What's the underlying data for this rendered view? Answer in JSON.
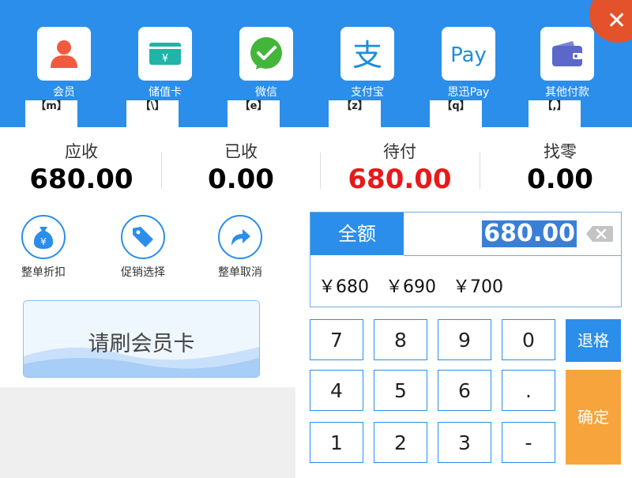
{
  "payments": [
    {
      "label": "会员",
      "key": "【m】",
      "icon": "member-icon"
    },
    {
      "label": "储值卡",
      "key": "【\\】",
      "icon": "stored-card-icon"
    },
    {
      "label": "微信",
      "key": "【e】",
      "icon": "wechat-icon"
    },
    {
      "label": "支付宝",
      "key": "【z】",
      "icon": "alipay-icon"
    },
    {
      "label": "思迅Pay",
      "key": "【q】",
      "icon": "sixun-pay-icon"
    },
    {
      "label": "其他付款",
      "key": "【,】",
      "icon": "wallet-icon"
    }
  ],
  "payment_icon_texts": {
    "stored_card": "¥",
    "alipay": "支",
    "sixun_pay": "Pay"
  },
  "summary": {
    "receivable": {
      "label": "应收",
      "value": "680.00"
    },
    "received": {
      "label": "已收",
      "value": "0.00"
    },
    "pending": {
      "label": "待付",
      "value": "680.00"
    },
    "change": {
      "label": "找零",
      "value": "0.00"
    }
  },
  "tools": [
    {
      "label": "整单折扣",
      "icon": "money-bag-icon",
      "glyph": "¥"
    },
    {
      "label": "促销选择",
      "icon": "tag-icon"
    },
    {
      "label": "整单取消",
      "icon": "redo-arrow-icon"
    }
  ],
  "card_button": "请刷会员卡",
  "amount": {
    "full_label": "全额",
    "value": "680.00"
  },
  "quick_amounts": [
    "￥680",
    "￥690",
    "￥700"
  ],
  "keypad": {
    "rows": [
      [
        "7",
        "8",
        "9",
        "0"
      ],
      [
        "4",
        "5",
        "6",
        "."
      ],
      [
        "1",
        "2",
        "3",
        "-"
      ]
    ],
    "backspace": "退格",
    "confirm": "确定"
  },
  "close_glyph": "✕",
  "colors": {
    "header": "#2b8eea",
    "pending_red": "#e8191b",
    "confirm_orange": "#f7a43c",
    "close_red": "#e3522a"
  }
}
